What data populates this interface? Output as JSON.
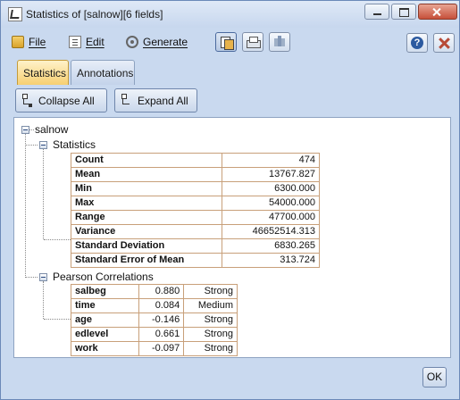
{
  "window": {
    "title": "Statistics of [salnow][6 fields]"
  },
  "menu": {
    "file": "File",
    "edit": "Edit",
    "generate": "Generate"
  },
  "tabs": [
    {
      "label": "Statistics",
      "active": true
    },
    {
      "label": "Annotations",
      "active": false
    }
  ],
  "toolbar": {
    "collapse_all": "Collapse All",
    "expand_all": "Expand All"
  },
  "tree": {
    "root": "salnow",
    "statistics_label": "Statistics",
    "statistics": [
      {
        "name": "Count",
        "value": "474"
      },
      {
        "name": "Mean",
        "value": "13767.827"
      },
      {
        "name": "Min",
        "value": "6300.000"
      },
      {
        "name": "Max",
        "value": "54000.000"
      },
      {
        "name": "Range",
        "value": "47700.000"
      },
      {
        "name": "Variance",
        "value": "46652514.313"
      },
      {
        "name": "Standard Deviation",
        "value": "6830.265"
      },
      {
        "name": "Standard Error of Mean",
        "value": "313.724"
      }
    ],
    "correlations_label": "Pearson Correlations",
    "correlations": [
      {
        "field": "salbeg",
        "value": "0.880",
        "strength": "Strong"
      },
      {
        "field": "time",
        "value": "0.084",
        "strength": "Medium"
      },
      {
        "field": "age",
        "value": "-0.146",
        "strength": "Strong"
      },
      {
        "field": "edlevel",
        "value": "0.661",
        "strength": "Strong"
      },
      {
        "field": "work",
        "value": "-0.097",
        "strength": "Strong"
      }
    ]
  },
  "footer": {
    "ok": "OK"
  },
  "colors": {
    "active_tab": "#f6cf71",
    "table_border": "#c8a07a",
    "window_bg": "#c9d9ef"
  }
}
